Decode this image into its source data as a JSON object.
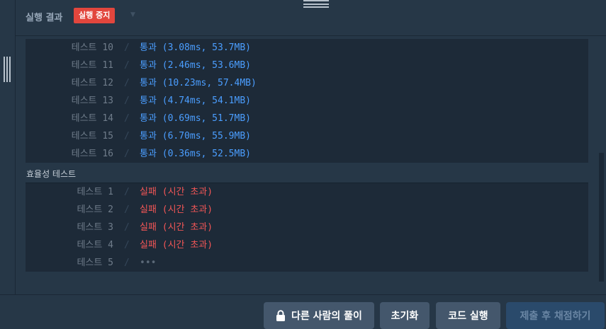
{
  "header": {
    "title": "실행 결과",
    "stop_label": "실행 중지",
    "caret_icon": "chevron-down-icon"
  },
  "results": [
    {
      "label": "테스트 10",
      "status": "pass",
      "value": "통과 (3.08ms, 53.7MB)"
    },
    {
      "label": "테스트 11",
      "status": "pass",
      "value": "통과 (2.46ms, 53.6MB)"
    },
    {
      "label": "테스트 12",
      "status": "pass",
      "value": "통과 (10.23ms, 57.4MB)"
    },
    {
      "label": "테스트 13",
      "status": "pass",
      "value": "통과 (4.74ms, 54.1MB)"
    },
    {
      "label": "테스트 14",
      "status": "pass",
      "value": "통과 (0.69ms, 51.7MB)"
    },
    {
      "label": "테스트 15",
      "status": "pass",
      "value": "통과 (6.70ms, 55.9MB)"
    },
    {
      "label": "테스트 16",
      "status": "pass",
      "value": "통과 (0.36ms, 52.5MB)"
    }
  ],
  "efficiency": {
    "section_label": "효율성  테스트",
    "rows": [
      {
        "label": "테스트 1",
        "status": "fail",
        "value": "실패 (시간 초과)"
      },
      {
        "label": "테스트 2",
        "status": "fail",
        "value": "실패 (시간 초과)"
      },
      {
        "label": "테스트 3",
        "status": "fail",
        "value": "실패 (시간 초과)"
      },
      {
        "label": "테스트 4",
        "status": "fail",
        "value": "실패 (시간 초과)"
      },
      {
        "label": "테스트 5",
        "status": "pending",
        "value": "•••"
      }
    ]
  },
  "footer": {
    "solutions_label": "다른 사람의 풀이",
    "reset_label": "초기화",
    "run_label": "코드 실행",
    "submit_label": "제출 후 채점하기"
  },
  "colors": {
    "pass": "#4b9eff",
    "fail": "#f25656",
    "stop_badge": "#e2463d",
    "background": "#263747",
    "result_bg": "#1d2a38"
  }
}
